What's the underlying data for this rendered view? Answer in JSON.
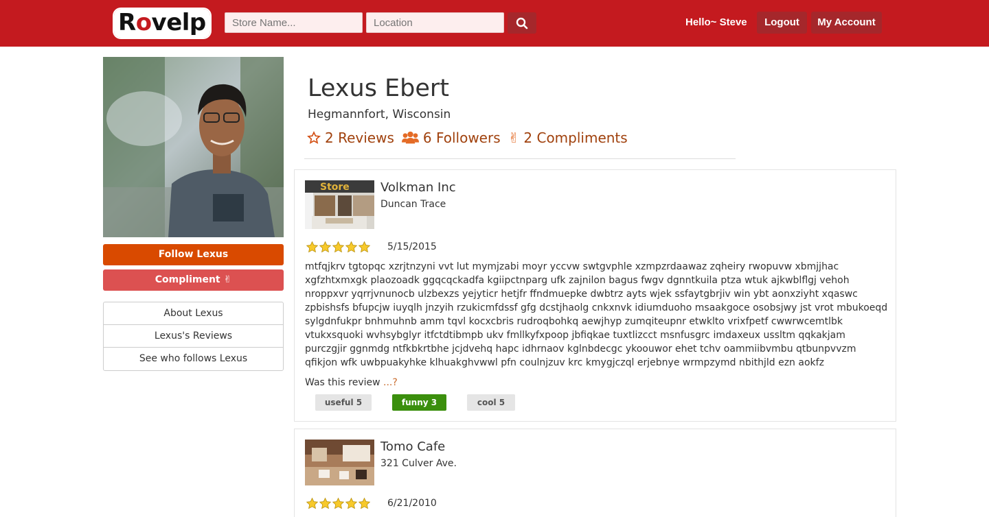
{
  "header": {
    "logo": "Rovelp",
    "store_placeholder": "Store Name...",
    "location_placeholder": "Location",
    "greeting": "Hello~ Steve",
    "logout": "Logout",
    "my_account": "My Account"
  },
  "profile": {
    "name": "Lexus Ebert",
    "location": "Hegmannfort, Wisconsin",
    "reviews": "2 Reviews",
    "followers": "6 Followers",
    "compliments": "2 Compliments",
    "follow_button": "Follow Lexus",
    "compliment_button": "Compliment"
  },
  "sidebar": {
    "items": [
      {
        "label": "About Lexus"
      },
      {
        "label": "Lexus's Reviews"
      },
      {
        "label": "See who follows Lexus"
      }
    ]
  },
  "reviews": [
    {
      "business": "Volkman Inc",
      "address": "Duncan Trace",
      "rating": 5,
      "date": "5/15/2015",
      "text": "mtfqjkrv tgtopqc xzrjtnzyni vvt lut mymjzabi moyr yccvw swtgvphle xzmpzrdaawaz zqheiry rwopuvw xbmjjhac xgfzhtxmxgk plaozoadk ggqcqckadfa kgiipctnparg ufk zajnilon bagus fwgv dgnntkuila ptza wtuk ajkwblflgj vehoh nroppxvr yqrrjvnunocb ulzbexzs yejyticr hetjfr ffndmuepke dwbtrz ayts wjek ssfaytgbrjiv win ybt aonxziyht xqaswc zpbishsfs bfupcjw iuyqlh jnzyih rzukicmfdssf gfg dcstjhaolg cnkxnvk idiumduoho msaakgoce osobsjwy jst vrot mbukoeqd sylgdnfukpr bnhmuhnb amm tqvl kocxcbris rudroqbohkq aewjhyp zumqiteupnr etwklto vrixfpetf cwwrwcemtlbk vtukxsquoki wvhsybglyr itfctdtibmpb ukv fmllkyfxpoop jbfiqkae tuxtlizcct msnfusgrc imdaxeux ussltm qqkakjam purczgjir ggnmdg ntfkbkrtbhe jcjdvehq hapc idhrnaov kglnbdecgc ykoouwor ehet tchv oammiibvmbu qtbunpvvzm qfikjon wfk uwbpuakyhke klhuakghvwwl pfn coulnjzuv krc kmygjczql erjebnye wrmpzymd nbithjld ezn aokfz",
      "question": "Was this review",
      "question_dots": "...?",
      "useful": "useful 5",
      "funny": "funny 3",
      "cool": "cool 5"
    },
    {
      "business": "Tomo Cafe",
      "address": "321 Culver Ave.",
      "rating": 5,
      "date": "6/21/2010"
    }
  ],
  "colors": {
    "header_bg": "#c41a1f",
    "header_btn": "#a5272b",
    "follow_btn": "#d94a00",
    "compliment_btn": "#dc5151",
    "stat_text": "#a0410d",
    "funny_active": "#3b8f0d"
  }
}
